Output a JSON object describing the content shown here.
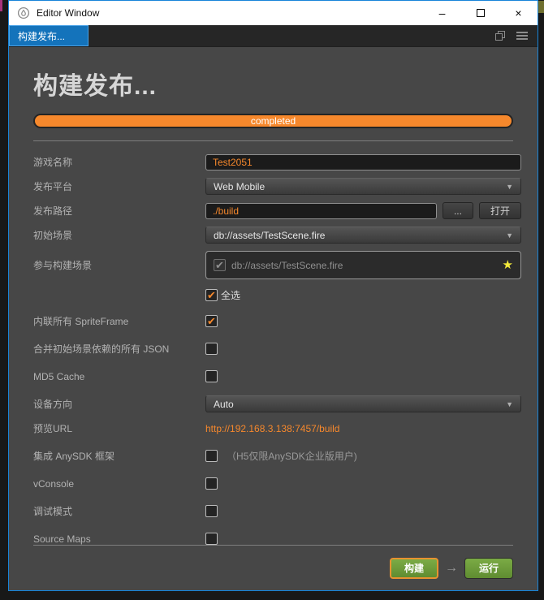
{
  "colors": {
    "accent_orange": "#f6882c",
    "tab_blue": "#1473bb",
    "button_green": "#6fa03c",
    "star_yellow": "#f3e93a",
    "window_border_blue": "#1884d9"
  },
  "titlebar": {
    "title": "Editor Window"
  },
  "tabbar": {
    "tab_label": "构建发布..."
  },
  "ui": {
    "icons": {
      "minimize": "–",
      "close": "×",
      "check": "✔",
      "dropdown_arrow": "▼",
      "star": "★",
      "flow_arrow": "→"
    }
  },
  "panel": {
    "heading": "构建发布...",
    "progress": {
      "label": "completed",
      "percent": 100
    }
  },
  "form": {
    "game_name": {
      "label": "游戏名称",
      "value": "Test2051"
    },
    "platform": {
      "label": "发布平台",
      "value": "Web Mobile"
    },
    "build_path": {
      "label": "发布路径",
      "value": "./build",
      "browse_label": "...",
      "open_label": "打开"
    },
    "start_scene": {
      "label": "初始场景",
      "value": "db://assets/TestScene.fire"
    },
    "scenes": {
      "label": "参与构建场景",
      "item": "db://assets/TestScene.fire",
      "item_checked": true,
      "select_all_label": "全选",
      "select_all_checked": true
    },
    "inline_spriteframe": {
      "label": "内联所有 SpriteFrame",
      "checked": true
    },
    "merge_json": {
      "label": "合并初始场景依赖的所有 JSON",
      "checked": false
    },
    "md5_cache": {
      "label": "MD5 Cache",
      "checked": false
    },
    "orientation": {
      "label": "设备方向",
      "value": "Auto"
    },
    "preview_url": {
      "label": "预览URL",
      "value": "http://192.168.3.138:7457/build"
    },
    "anysdk": {
      "label": "集成 AnySDK 框架",
      "checked": false,
      "note": "（H5仅限AnySDK企业版用户)"
    },
    "vconsole": {
      "label": "vConsole",
      "checked": false
    },
    "debug_mode": {
      "label": "调试模式",
      "checked": false
    },
    "source_maps": {
      "label": "Source Maps",
      "checked": false
    }
  },
  "footer": {
    "build_label": "构建",
    "run_label": "运行"
  }
}
